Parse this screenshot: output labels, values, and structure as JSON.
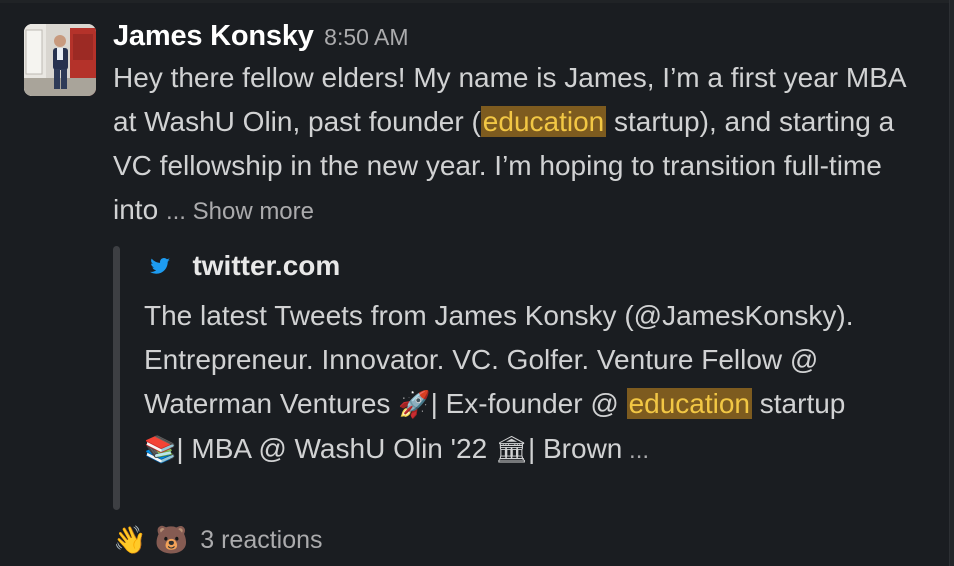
{
  "message": {
    "author": "James Konsky",
    "time": "8:50 AM",
    "text_part1": "Hey there fellow elders! My name is James, I’m a first year MBA at WashU Olin, past founder (",
    "highlight": "education",
    "text_part2": " startup), and starting a VC fellowship in the new year. I’m hoping to transition full-time into",
    "show_more": "... Show more"
  },
  "unfurl": {
    "source": "twitter.com",
    "source_icon": "twitter-bird-icon",
    "text_part1": "The latest Tweets from James Konsky (@JamesKonsky). Entrepreneur. Innovator. VC. Golfer. Venture Fellow @ Waterman Ventures ",
    "emoji_rocket": "🚀",
    "text_part2": "| Ex-founder @ ",
    "highlight": "education",
    "text_part3": " startup ",
    "emoji_books": "📚",
    "text_part4": "| MBA @ WashU Olin '22 ",
    "emoji_classical": "🏛",
    "text_part5": "| Brown",
    "ellipsis": " ..."
  },
  "reactions": {
    "emoji_wave": "👋",
    "emoji_bear": "🐻",
    "count_label": "3 reactions"
  },
  "colors": {
    "background": "#1a1d21",
    "highlight_bg": "#7d5b1f",
    "highlight_text": "#f2c744",
    "twitter_blue": "#1d9bf0"
  }
}
